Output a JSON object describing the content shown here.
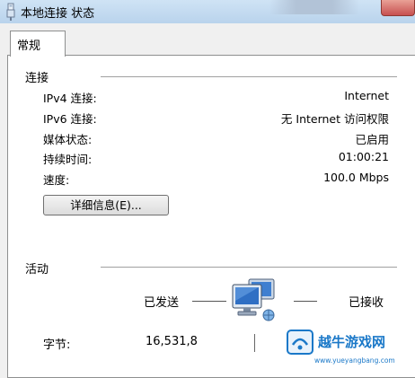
{
  "window": {
    "title": "本地连接 状态"
  },
  "tabs": [
    {
      "label": "常规",
      "selected": true
    }
  ],
  "connection": {
    "heading": "连接",
    "rows": [
      {
        "label": "IPv4 连接:",
        "value": "Internet"
      },
      {
        "label": "IPv6 连接:",
        "value": "无 Internet 访问权限"
      },
      {
        "label": "媒体状态:",
        "value": "已启用"
      },
      {
        "label": "持续时间:",
        "value": "01:00:21"
      },
      {
        "label": "速度:",
        "value": "100.0 Mbps"
      }
    ],
    "details_button": "详细信息(E)..."
  },
  "activity": {
    "heading": "活动",
    "sent_label": "已发送",
    "received_label": "已接收",
    "bytes_label": "字节:",
    "bytes_sent": "16,531,8"
  },
  "watermark": {
    "text": "越牛游戏网",
    "url": "www.yueyangbang.com"
  },
  "colors": {
    "close_button": "#c75050",
    "titlebar": "#c3dbf2",
    "watermark_blue": "#1a78c8"
  }
}
